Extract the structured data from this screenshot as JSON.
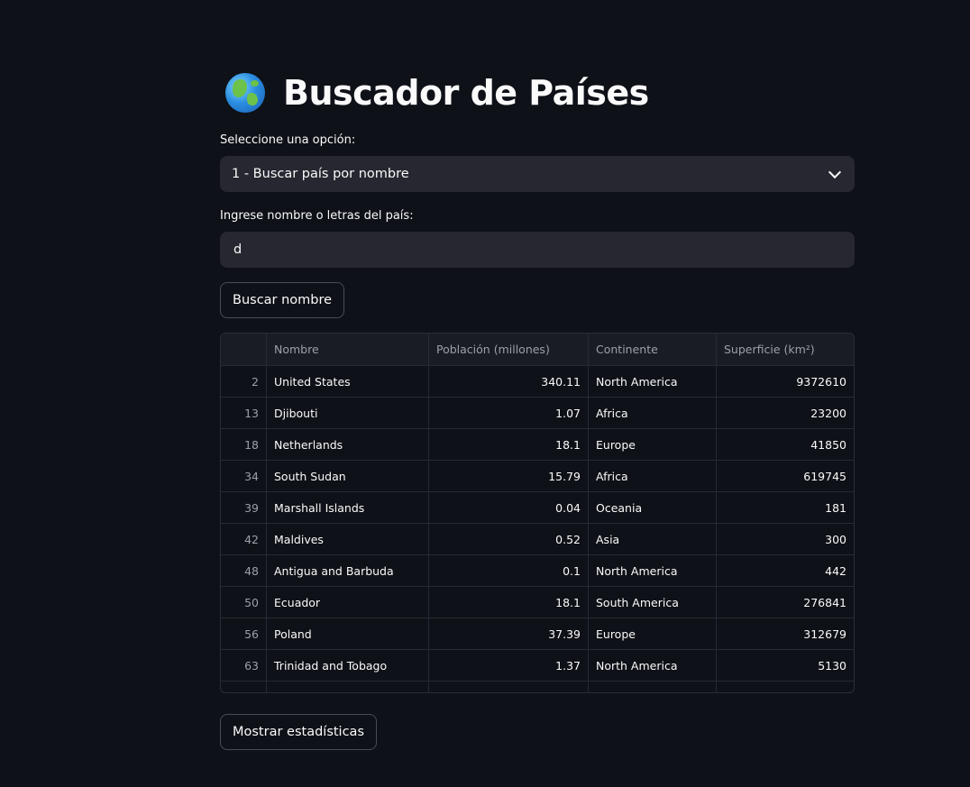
{
  "title": "Buscador de Países",
  "select": {
    "label": "Seleccione una opción:",
    "value": "1 - Buscar país por nombre"
  },
  "input": {
    "label": "Ingrese nombre o letras del país:",
    "value": "d"
  },
  "buttons": {
    "search": "Buscar nombre",
    "stats": "Mostrar estadísticas"
  },
  "table": {
    "columns": [
      "",
      "Nombre",
      "Población (millones)",
      "Continente",
      "Superficie (km²)"
    ],
    "rows": [
      [
        "2",
        "United States",
        "340.11",
        "North America",
        "9372610"
      ],
      [
        "13",
        "Djibouti",
        "1.07",
        "Africa",
        "23200"
      ],
      [
        "18",
        "Netherlands",
        "18.1",
        "Europe",
        "41850"
      ],
      [
        "34",
        "South Sudan",
        "15.79",
        "Africa",
        "619745"
      ],
      [
        "39",
        "Marshall Islands",
        "0.04",
        "Oceania",
        "181"
      ],
      [
        "42",
        "Maldives",
        "0.52",
        "Asia",
        "300"
      ],
      [
        "48",
        "Antigua and Barbuda",
        "0.1",
        "North America",
        "442"
      ],
      [
        "50",
        "Ecuador",
        "18.1",
        "South America",
        "276841"
      ],
      [
        "56",
        "Poland",
        "37.39",
        "Europe",
        "312679"
      ],
      [
        "63",
        "Trinidad and Tobago",
        "1.37",
        "North America",
        "5130"
      ],
      [
        "",
        "",
        "",
        "",
        ""
      ]
    ]
  }
}
